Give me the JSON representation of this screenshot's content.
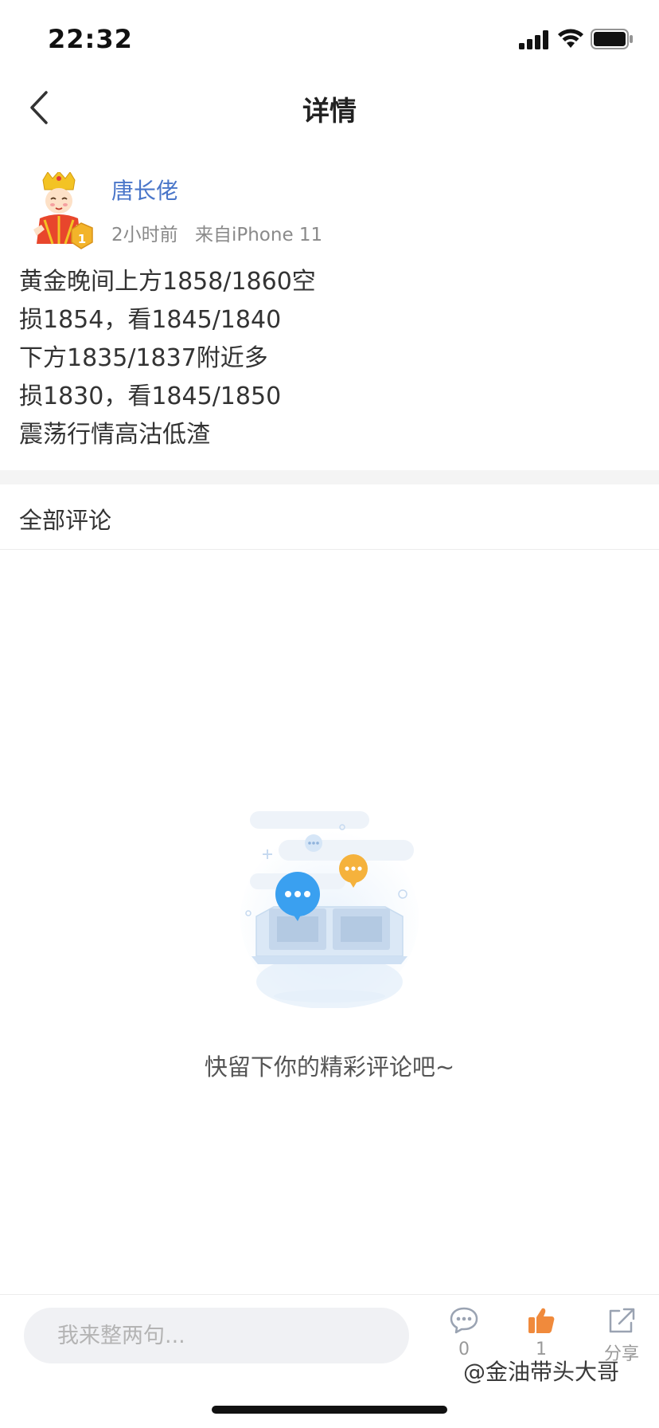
{
  "status_bar": {
    "time": "22:32"
  },
  "nav": {
    "title": "详情"
  },
  "post": {
    "author": "唐长佬",
    "time_ago": "2小时前",
    "source": "来自iPhone 11",
    "badge_level": "1",
    "lines": [
      "黄金晚间上方1858/1860空",
      "损1854，看1845/1840",
      "下方1835/1837附近多",
      "损1830，看1845/1850",
      "震荡行情高沽低渣"
    ]
  },
  "comments": {
    "title": "全部评论",
    "empty_text": "快留下你的精彩评论吧~"
  },
  "bottom_bar": {
    "input_placeholder": "我来整两句...",
    "comment_count": "0",
    "like_count": "1",
    "share_label": "分享"
  },
  "watermark": "@金油带头大哥",
  "colors": {
    "author_link": "#4a76c9",
    "like_active": "#f08a3c",
    "bubble_blue": "#3aa0f0",
    "bubble_orange": "#f5b23c"
  }
}
